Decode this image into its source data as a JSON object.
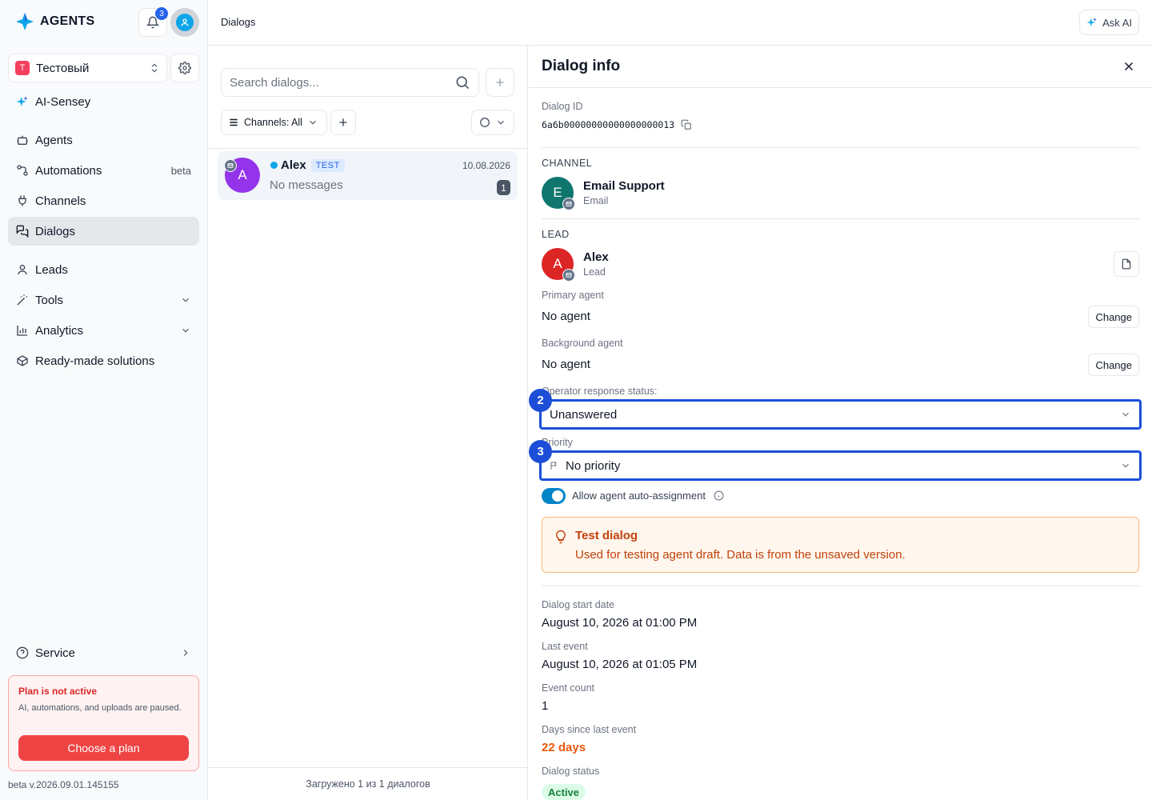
{
  "brand": {
    "name": "AGENTS"
  },
  "notifications": {
    "count": "3"
  },
  "workspace": {
    "letter": "T",
    "name": "Тестовый"
  },
  "sidebar": {
    "ai_item": "AI-Sensey",
    "items": [
      {
        "label": "Agents",
        "icon": "robot-icon"
      },
      {
        "label": "Automations",
        "icon": "workflow-icon",
        "tag": "beta"
      },
      {
        "label": "Channels",
        "icon": "plug-icon"
      },
      {
        "label": "Dialogs",
        "icon": "chat-icon",
        "active": true
      },
      {
        "label": "Leads",
        "icon": "user-icon"
      },
      {
        "label": "Tools",
        "icon": "wand-icon"
      },
      {
        "label": "Analytics",
        "icon": "bar-chart-icon"
      },
      {
        "label": "Ready-made solutions",
        "icon": "box-icon"
      }
    ],
    "service": "Service"
  },
  "plan": {
    "title": "Plan is not active",
    "desc": "AI, automations, and uploads are paused.",
    "button": "Choose a plan"
  },
  "version": "beta v.2026.09.01.145155",
  "header": {
    "breadcrumb": "Dialogs",
    "ask_ai": "Ask AI"
  },
  "list": {
    "search_placeholder": "Search dialogs...",
    "filter_label": "Channels: All",
    "footer": "Загружено 1 из 1 диалогов",
    "rows": [
      {
        "avatar": "A",
        "name": "Alex",
        "tag": "TEST",
        "date": "10.08.2026",
        "preview": "No messages",
        "count": "1"
      }
    ]
  },
  "info": {
    "title": "Dialog info",
    "dialog_id_label": "Dialog ID",
    "dialog_id": "6a6b00000000000000000013",
    "channel_cap": "CHANNEL",
    "channel": {
      "avatar": "E",
      "name": "Email Support",
      "type": "Email"
    },
    "lead_cap": "LEAD",
    "lead": {
      "avatar": "A",
      "name": "Alex",
      "type": "Lead"
    },
    "primary_label": "Primary agent",
    "primary_value": "No agent",
    "background_label": "Background agent",
    "background_value": "No agent",
    "change": "Change",
    "status_label": "Operator response status:",
    "status_value": "Unanswered",
    "priority_label": "Priority",
    "priority_value": "No priority",
    "marker_status": "2",
    "marker_priority": "3",
    "auto_assign": "Allow agent auto-assignment",
    "auto_assign_on": true,
    "notice_title": "Test dialog",
    "notice_desc": "Used for testing agent draft. Data is from the unsaved version.",
    "start_label": "Dialog start date",
    "start_value": "August 10, 2026 at 01:00 PM",
    "last_label": "Last event",
    "last_value": "August 10, 2026 at 01:05 PM",
    "count_label": "Event count",
    "count_value": "1",
    "days_label": "Days since last event",
    "days_value": "22 days",
    "dstatus_label": "Dialog status",
    "dstatus_value": "Active"
  },
  "colors": {
    "accent": "#1d4ed8",
    "danger": "#ef4444",
    "warning": "#c2410c",
    "success": "#15803d"
  }
}
